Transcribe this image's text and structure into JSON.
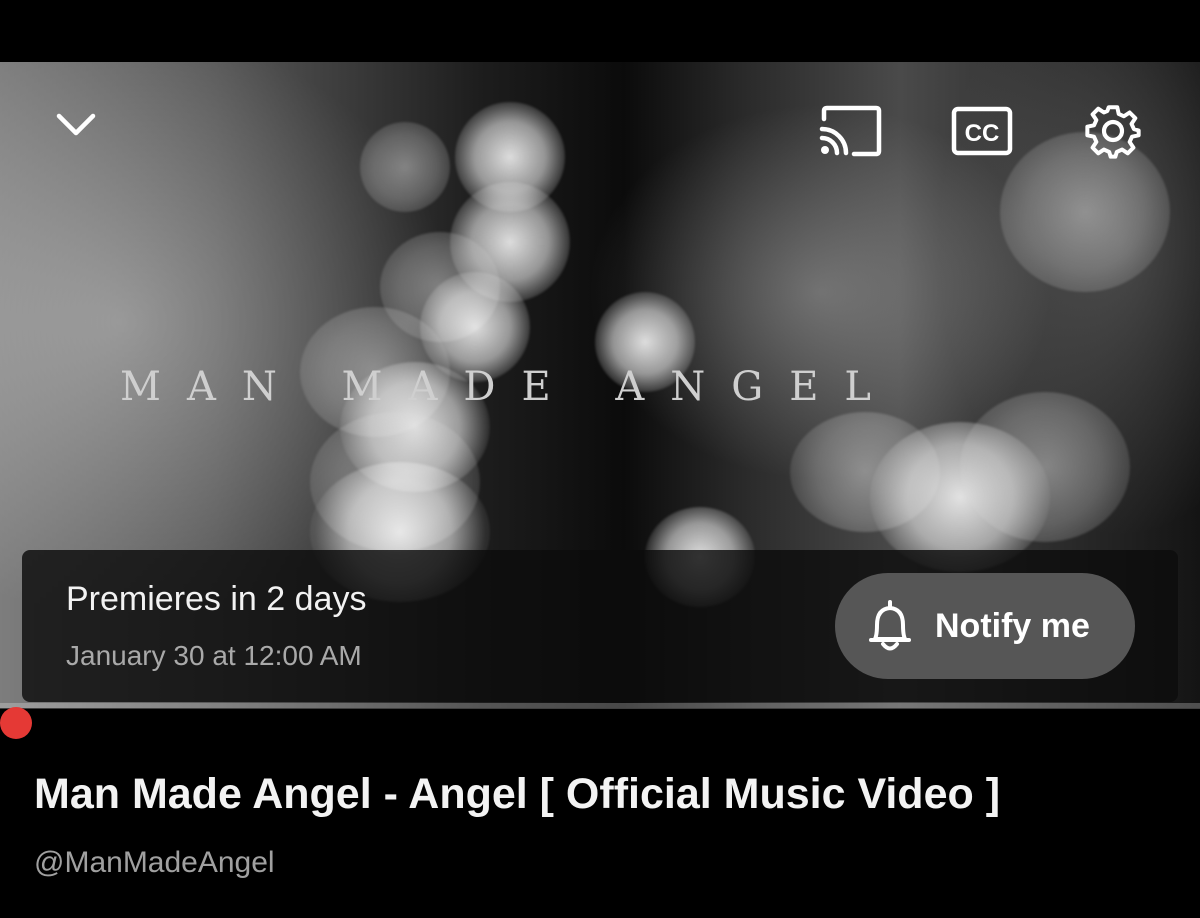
{
  "player": {
    "overlay_title": "MAN MADE ANGEL",
    "icons": {
      "collapse": "chevron-down-icon",
      "cast": "cast-icon",
      "captions": "closed-captions-icon",
      "settings": "gear-icon"
    },
    "captions_label": "CC"
  },
  "premiere": {
    "title": "Premieres in 2 days",
    "date": "January 30 at 12:00 AM",
    "notify_label": "Notify me",
    "notify_icon": "bell-icon"
  },
  "progress": {
    "fraction": 0.0,
    "color": "#e53935"
  },
  "video": {
    "title": "Man Made Angel - Angel [ Official Music Video ]",
    "channel": "@ManMadeAngel"
  }
}
